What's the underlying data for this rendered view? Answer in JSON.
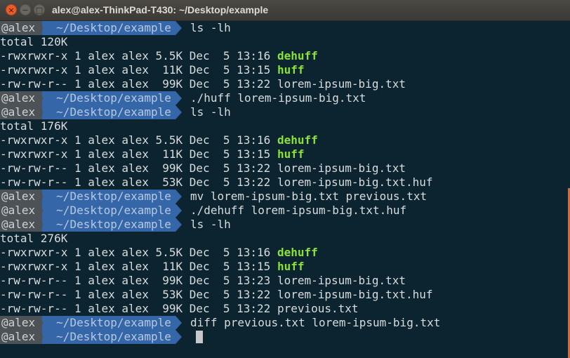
{
  "window": {
    "title": "alex@alex-ThinkPad-T430: ~/Desktop/example",
    "buttons": {
      "close": "×",
      "minimize": "−",
      "maximize": "□"
    }
  },
  "prompt": {
    "user": "@alex",
    "path": "~/Desktop/example"
  },
  "colors": {
    "background": "#0b2430",
    "prompt_user_bg": "#4d5256",
    "prompt_path_bg": "#3566a8",
    "executable": "#8ae234",
    "text": "#d8dcdc"
  },
  "terminal": {
    "cmd1": "ls -lh",
    "total1": "total 120K",
    "ls1": [
      {
        "meta": "-rwxrwxr-x 1 alex alex 5.5K Dec  5 13:16 ",
        "name": "dehuff",
        "exec": true
      },
      {
        "meta": "-rwxrwxr-x 1 alex alex  11K Dec  5 13:15 ",
        "name": "huff",
        "exec": true
      },
      {
        "meta": "-rw-rw-r-- 1 alex alex  99K Dec  5 13:22 ",
        "name": "lorem-ipsum-big.txt",
        "exec": false
      }
    ],
    "cmd2": "./huff lorem-ipsum-big.txt",
    "cmd3": "ls -lh",
    "total2": "total 176K",
    "ls2": [
      {
        "meta": "-rwxrwxr-x 1 alex alex 5.5K Dec  5 13:16 ",
        "name": "dehuff",
        "exec": true
      },
      {
        "meta": "-rwxrwxr-x 1 alex alex  11K Dec  5 13:15 ",
        "name": "huff",
        "exec": true
      },
      {
        "meta": "-rw-rw-r-- 1 alex alex  99K Dec  5 13:22 ",
        "name": "lorem-ipsum-big.txt",
        "exec": false
      },
      {
        "meta": "-rw-rw-r-- 1 alex alex  53K Dec  5 13:22 ",
        "name": "lorem-ipsum-big.txt.huf",
        "exec": false
      }
    ],
    "cmd4": "mv lorem-ipsum-big.txt previous.txt",
    "cmd5": "./dehuff lorem-ipsum-big.txt.huf",
    "cmd6": "ls -lh",
    "total3": "total 276K",
    "ls3": [
      {
        "meta": "-rwxrwxr-x 1 alex alex 5.5K Dec  5 13:16 ",
        "name": "dehuff",
        "exec": true
      },
      {
        "meta": "-rwxrwxr-x 1 alex alex  11K Dec  5 13:15 ",
        "name": "huff",
        "exec": true
      },
      {
        "meta": "-rw-rw-r-- 1 alex alex  99K Dec  5 13:23 ",
        "name": "lorem-ipsum-big.txt",
        "exec": false
      },
      {
        "meta": "-rw-rw-r-- 1 alex alex  53K Dec  5 13:22 ",
        "name": "lorem-ipsum-big.txt.huf",
        "exec": false
      },
      {
        "meta": "-rw-rw-r-- 1 alex alex  99K Dec  5 13:22 ",
        "name": "previous.txt",
        "exec": false
      }
    ],
    "cmd7": "diff previous.txt lorem-ipsum-big.txt",
    "cmd8": ""
  }
}
